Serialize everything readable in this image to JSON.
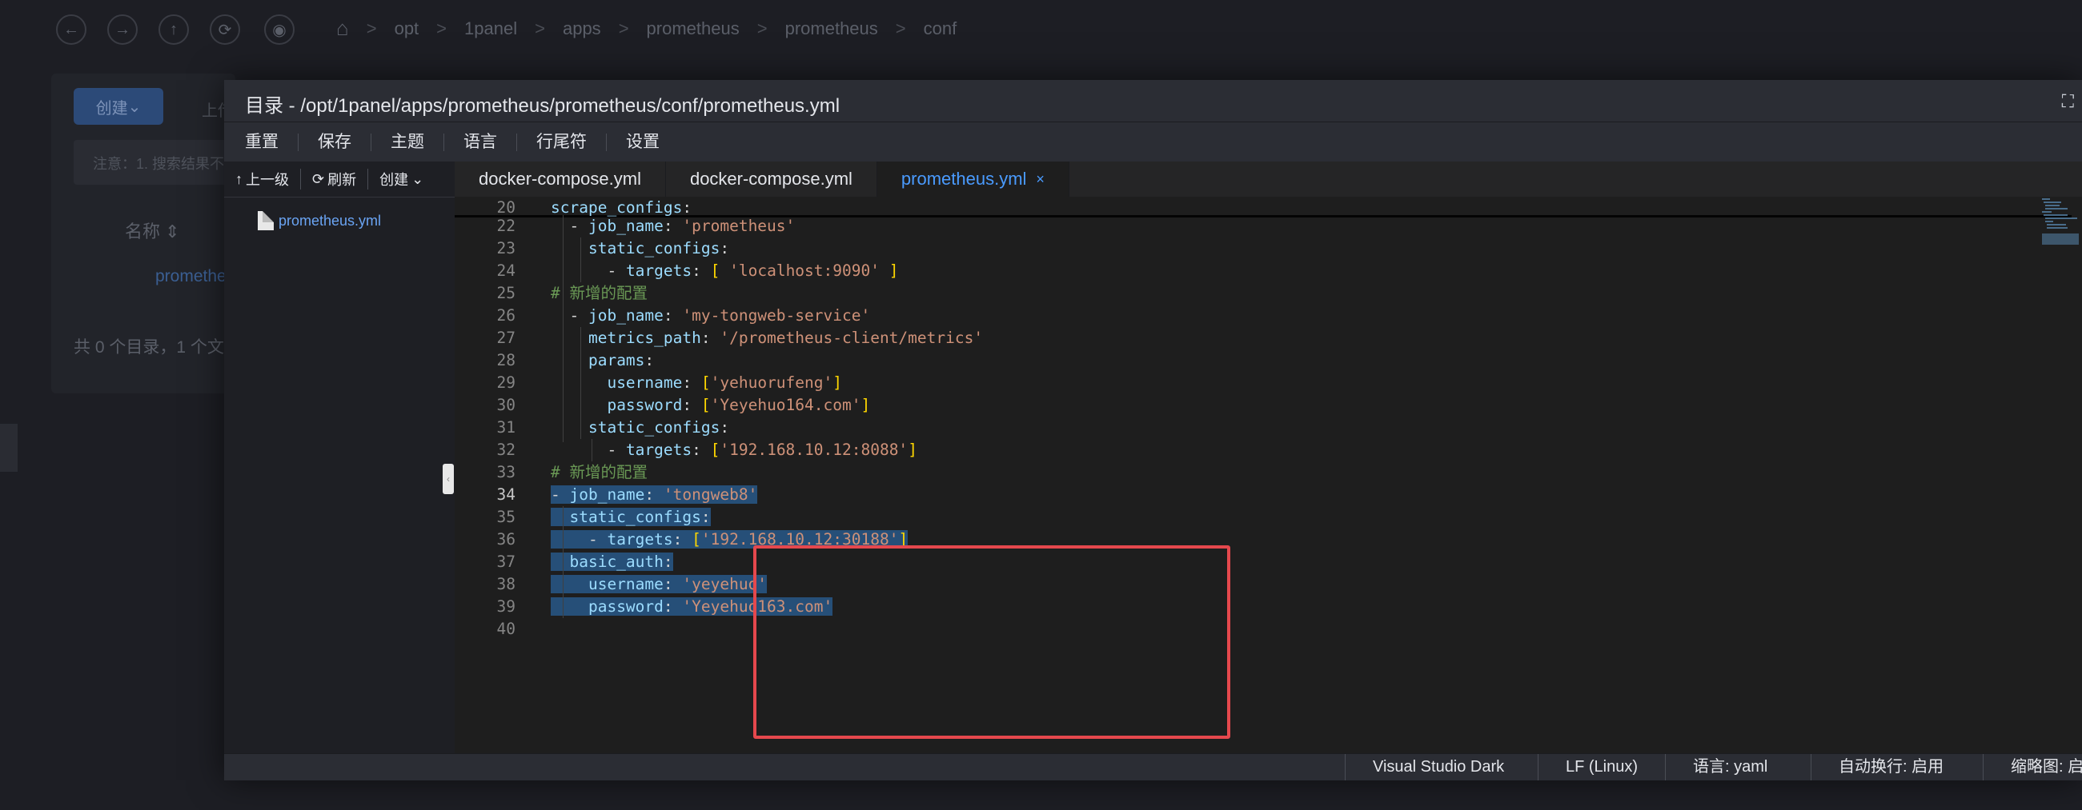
{
  "background": {
    "nav_icons": [
      "arrow-left-icon",
      "arrow-right-icon",
      "arrow-up-icon",
      "refresh-icon",
      "eye-icon"
    ],
    "breadcrumb": [
      "opt",
      "1panel",
      "apps",
      "prometheus",
      "prometheus",
      "conf"
    ],
    "create_button": "创建",
    "upload_fragment": "上传",
    "notice": "注意：1. 搜索结果不",
    "column_name": "名称",
    "file_name": "prometheus.yml",
    "summary": "共 0 个目录，1 个文"
  },
  "dialog": {
    "title": "目录 - /opt/1panel/apps/prometheus/prometheus/conf/prometheus.yml",
    "menu": [
      "重置",
      "保存",
      "主题",
      "语言",
      "行尾符",
      "设置"
    ],
    "sidebar": {
      "up_label": "上一级",
      "refresh_label": "刷新",
      "create_label": "创建",
      "file": "prometheus.yml"
    },
    "tabs": [
      {
        "label": "docker-compose.yml",
        "active": false
      },
      {
        "label": "docker-compose.yml",
        "active": false
      },
      {
        "label": "prometheus.yml",
        "active": true
      }
    ],
    "close_symbol": "×",
    "current_line": 34,
    "status": {
      "theme": "Visual Studio Dark",
      "eol": "LF (Linux)",
      "language": "语言: yaml",
      "word_wrap": "自动换行: 启用",
      "minimap": "缩略图: 启"
    }
  },
  "code_lines": [
    {
      "n": "20",
      "text": "scrape_configs:"
    },
    {
      "n": "22",
      "text": "  - job_name: 'prometheus'"
    },
    {
      "n": "23",
      "text": "    static_configs:"
    },
    {
      "n": "24",
      "text": "      - targets: [ 'localhost:9090' ]"
    },
    {
      "n": "25",
      "text": "# 新增的配置"
    },
    {
      "n": "26",
      "text": "  - job_name: 'my-tongweb-service'"
    },
    {
      "n": "27",
      "text": "    metrics_path: '/prometheus-client/metrics'"
    },
    {
      "n": "28",
      "text": "    params:"
    },
    {
      "n": "29",
      "text": "      username: ['yehuorufeng']"
    },
    {
      "n": "30",
      "text": "      password: ['Yeyehuo164.com']"
    },
    {
      "n": "31",
      "text": "    static_configs:"
    },
    {
      "n": "32",
      "text": "      - targets: ['192.168.10.12:8088']"
    },
    {
      "n": "33",
      "text": "# 新增的配置"
    },
    {
      "n": "34",
      "text": "- job_name: 'tongweb8'"
    },
    {
      "n": "35",
      "text": "  static_configs:"
    },
    {
      "n": "36",
      "text": "    - targets: ['192.168.10.12:30188']"
    },
    {
      "n": "37",
      "text": "  basic_auth:"
    },
    {
      "n": "38",
      "text": "    username: 'yeyehuo'"
    },
    {
      "n": "39",
      "text": "    password: 'Yeyehuo163.com'"
    },
    {
      "n": "40",
      "text": ""
    }
  ],
  "colors": {
    "accent": "#4a9bff",
    "highlight_box": "#e5484d",
    "selection": "#264f78"
  }
}
